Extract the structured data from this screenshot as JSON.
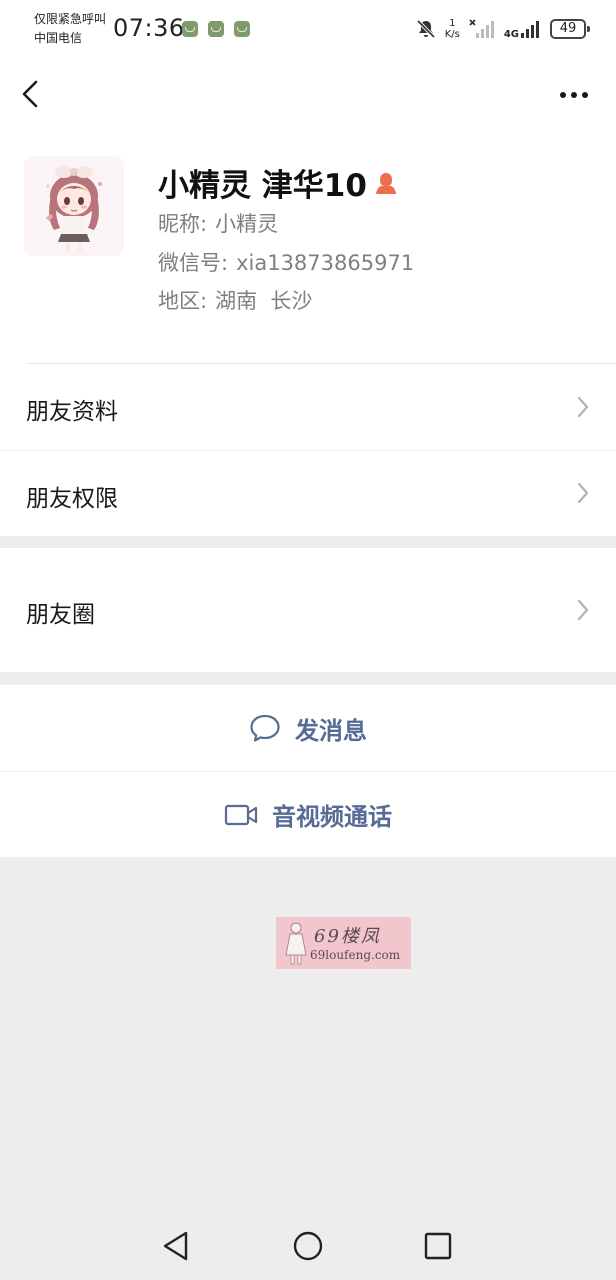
{
  "status_bar": {
    "carrier_line1": "仅限紧急呼叫",
    "carrier_line2": "中国电信",
    "time": "07:36",
    "notification_icons": [
      "app-notification-icon",
      "app-notification-icon",
      "app-notification-icon"
    ],
    "net_speed_value": "1",
    "net_speed_unit": "K/s",
    "network_type": "4G",
    "battery": "49"
  },
  "top_bar": {
    "back_icon": "chevron-left-icon",
    "more_icon": "more-dots-icon"
  },
  "profile": {
    "display_name": "小精灵 津华10",
    "gender_icon": "female-user-icon",
    "nickname_label": "昵称:",
    "nickname": "小精灵",
    "wechat_id_label": "微信号:",
    "wechat_id": "xia13873865971",
    "region_label": "地区:",
    "region": "湖南  长沙"
  },
  "menu": {
    "friend_profile": "朋友资料",
    "friend_permissions": "朋友权限",
    "moments": "朋友圈"
  },
  "actions": {
    "send_message": "发消息",
    "video_call": "音视频通话"
  },
  "watermark": {
    "title": "69楼凤",
    "url": "69loufeng.com"
  },
  "colors": {
    "accent": "#576b95",
    "page_bg": "#ededed",
    "cell_bg": "#ffffff",
    "gender_icon": "#f06e4d",
    "watermark_bg": "#f1c6cd"
  }
}
